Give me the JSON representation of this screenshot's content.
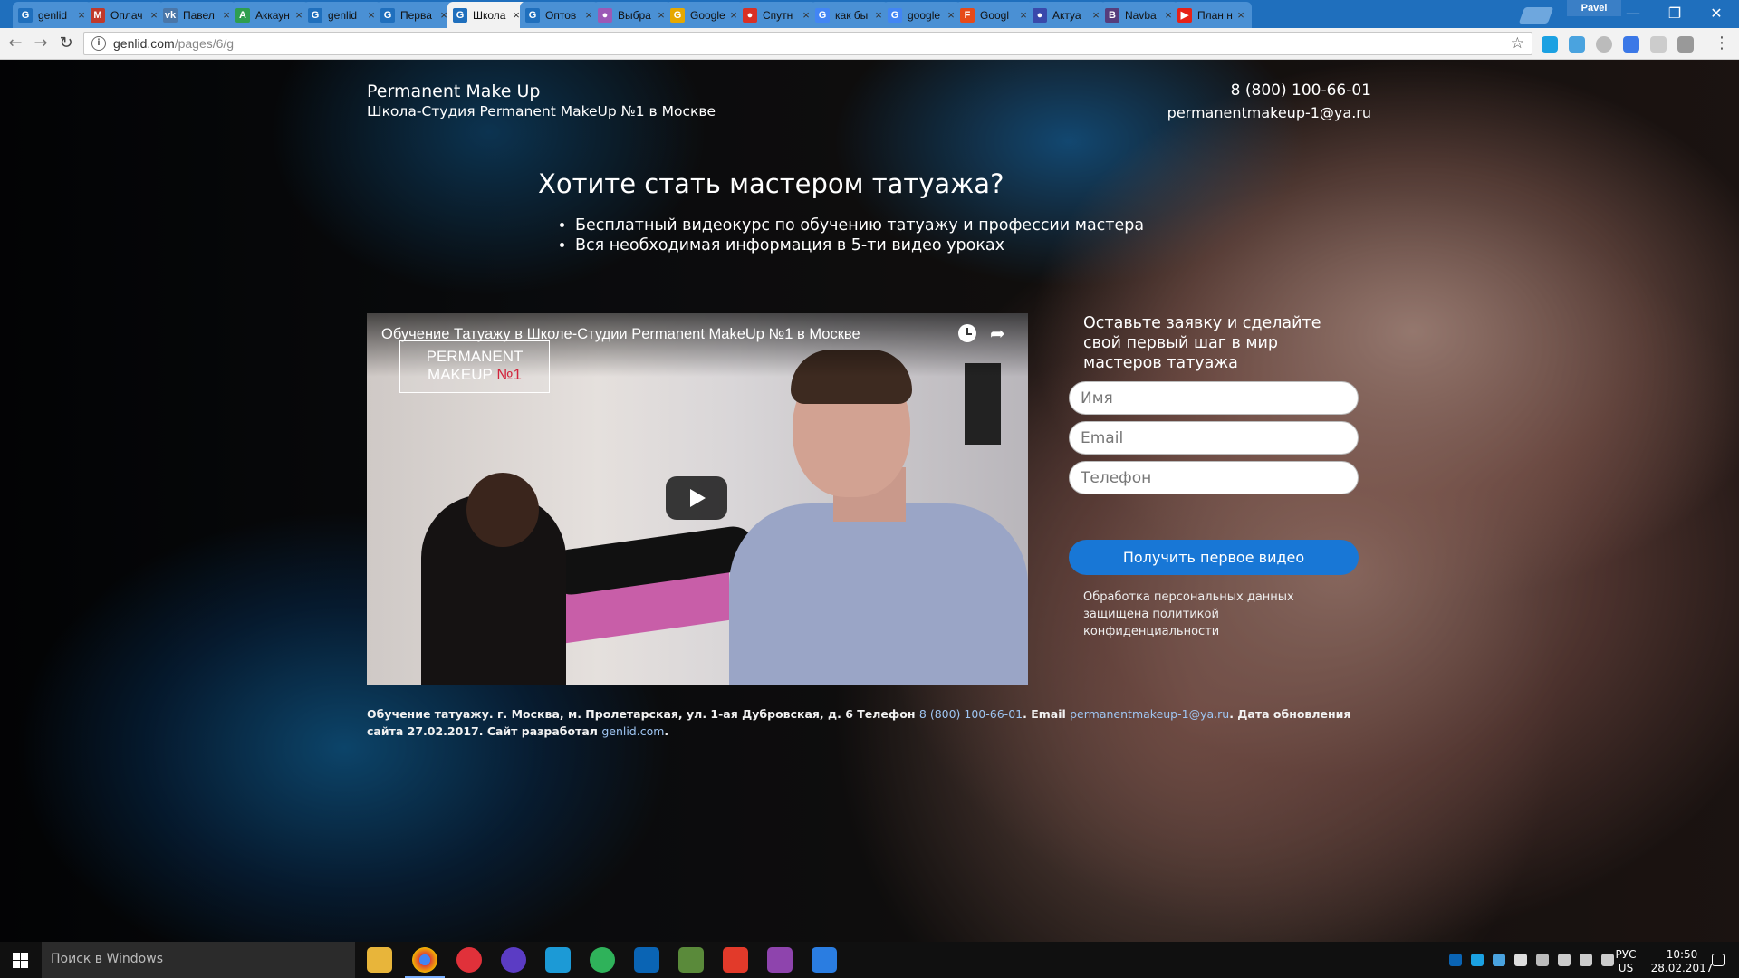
{
  "browser": {
    "tabs": [
      {
        "label": "genlid",
        "favicon": "G",
        "color": "#1f6fbd",
        "active": false
      },
      {
        "label": "Оплач",
        "favicon": "M",
        "color": "#c0392b",
        "active": false
      },
      {
        "label": "Павел",
        "favicon": "vk",
        "color": "#4a76a8",
        "active": false
      },
      {
        "label": "Аккаун",
        "favicon": "A",
        "color": "#2e9e4f",
        "active": false
      },
      {
        "label": "genlid",
        "favicon": "G",
        "color": "#1f6fbd",
        "active": false
      },
      {
        "label": "Перва",
        "favicon": "G",
        "color": "#1f6fbd",
        "active": false
      },
      {
        "label": "Школа",
        "favicon": "G",
        "color": "#1f6fbd",
        "active": true
      },
      {
        "label": "Оптов",
        "favicon": "G",
        "color": "#1f6fbd",
        "active": false
      },
      {
        "label": "Выбра",
        "favicon": "●",
        "color": "#9b59b6",
        "active": false
      },
      {
        "label": "Google",
        "favicon": "G",
        "color": "#e6a800",
        "active": false
      },
      {
        "label": "Спутн",
        "favicon": "●",
        "color": "#d93025",
        "active": false
      },
      {
        "label": "как бы",
        "favicon": "G",
        "color": "#4285f4",
        "active": false
      },
      {
        "label": "google",
        "favicon": "G",
        "color": "#4285f4",
        "active": false
      },
      {
        "label": "Googl",
        "favicon": "F",
        "color": "#e64a19",
        "active": false
      },
      {
        "label": "Актуа",
        "favicon": "●",
        "color": "#3949ab",
        "active": false
      },
      {
        "label": "Navba",
        "favicon": "B",
        "color": "#563d7c",
        "active": false
      },
      {
        "label": "План н",
        "favicon": "▶",
        "color": "#e62117",
        "active": false
      }
    ],
    "profile_name": "Pavel",
    "url_host": "genlid.com",
    "url_path": "/pages/6/g"
  },
  "page": {
    "brand_title": "Permanent Make Up",
    "brand_subtitle": "Школа-Студия Permanent MakeUp №1 в Москве",
    "phone": "8 (800) 100-66-01",
    "email": "permanentmakeup-1@ya.ru",
    "headline": "Хотите стать мастером татуажа?",
    "bullets": [
      "Бесплатный видеокурс по обучению татуажу и профессии мастера",
      "Вся необходимая информация в 5-ти видео уроках"
    ],
    "video": {
      "title": "Обучение Татуажу в Школе-Студии Permanent MakeUp №1 в Москве",
      "logo_line1": "PERMANENT",
      "logo_line2": "MAKEUP",
      "logo_num": "№1"
    },
    "form": {
      "heading": "Оставьте заявку и сделайте свой первый шаг в мир мастеров татуажа",
      "name_placeholder": "Имя",
      "email_placeholder": "Email",
      "phone_placeholder": "Телефон",
      "submit_label": "Получить первое видео",
      "privacy": "Обработка персональных данных защищена политикой конфиденциальности"
    },
    "footer": {
      "part1": "Обучение татуажу. г. Москва, м. Пролетарская, ул. 1-ая Дубровская, д. 6 Телефон ",
      "phone": "8 (800) 100-66-01",
      "part2": ". Email ",
      "email": "permanentmakeup-1@ya.ru",
      "part3": ". Дата обновления сайта 27.02.2017. Сайт разработал ",
      "site": "genlid.com",
      "part4": "."
    }
  },
  "taskbar": {
    "search_placeholder": "Поиск в Windows",
    "lang_line1": "РУС",
    "lang_line2": "US",
    "time": "10:50",
    "date": "28.02.2017"
  }
}
